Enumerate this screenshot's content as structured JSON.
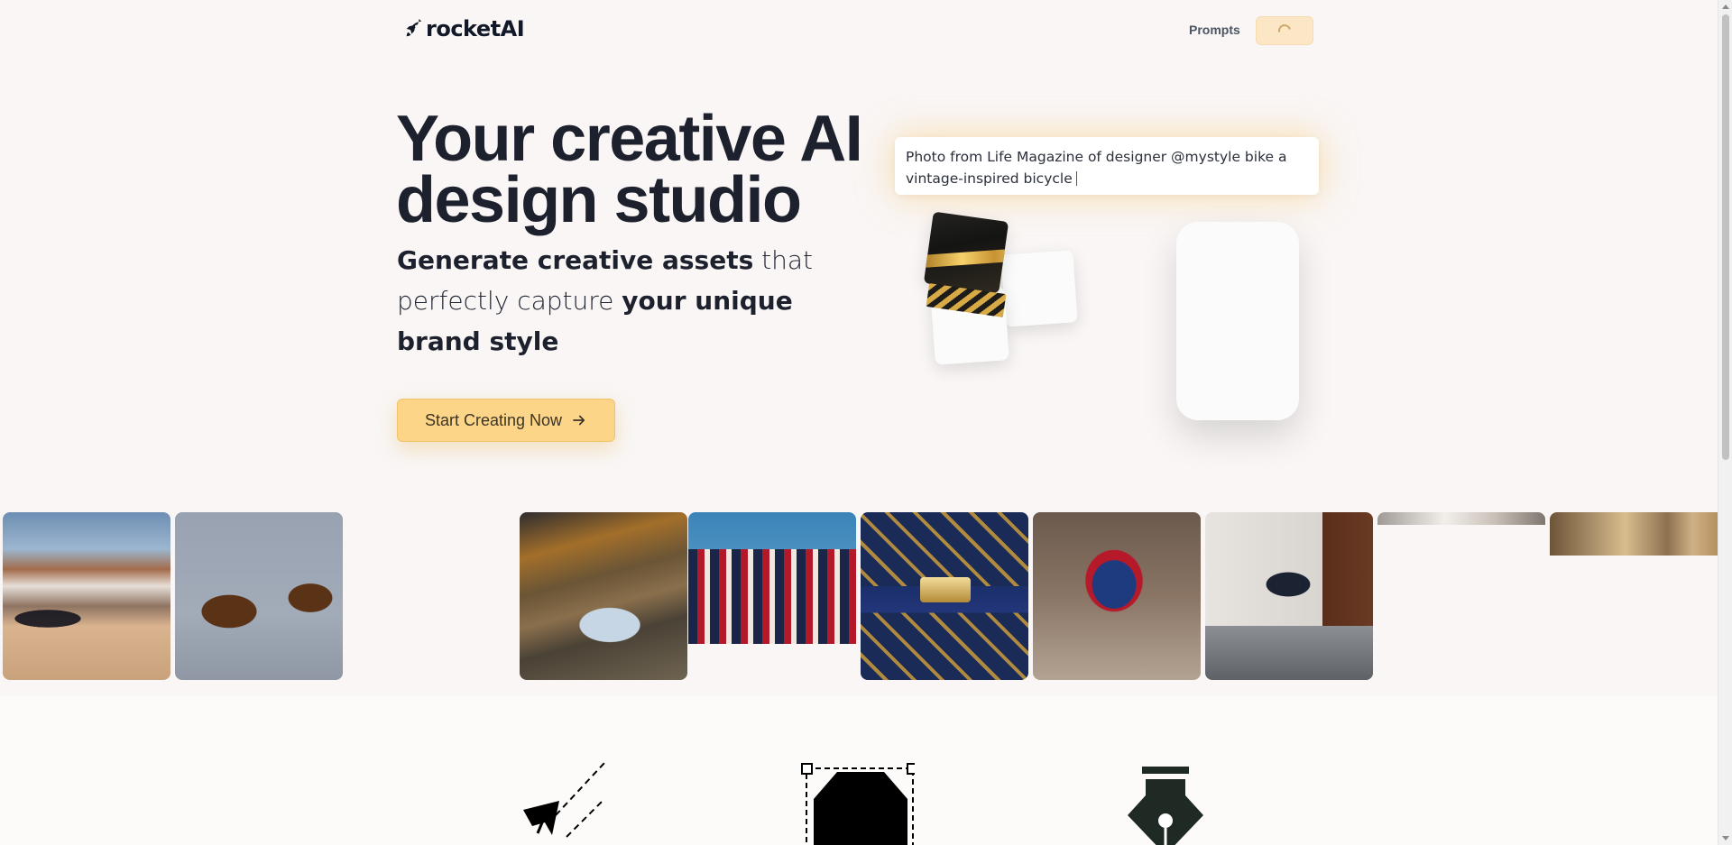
{
  "header": {
    "logo_text": "rocketAI",
    "logo_icon": "rocket-icon",
    "nav_prompts": "Prompts",
    "loading_icon": "spinner-icon"
  },
  "hero": {
    "title": "Your creative AI design studio",
    "subtitle": {
      "part1_bold": "Generate creative assets",
      "part2": " that perfectly capture ",
      "part3_bold": "your unique brand style"
    },
    "cta_label": "Start Creating Now",
    "cta_icon": "arrow-right-icon"
  },
  "prompt_box": {
    "text": "Photo from Life Magazine of designer @mystyle bike a vintage-inspired bicycle"
  },
  "gallery": {
    "tiles": [
      "mountain-sunglasses-image",
      "sunglasses-closeup-image",
      "sports-car-road-image",
      "striped-handbag-image",
      "gold-pattern-handbag-image",
      "red-blue-chair-image",
      "navy-chair-room-image",
      "interior-room-image",
      "interior-wall-image"
    ]
  },
  "features": {
    "icons": [
      "paper-plane-icon",
      "octagon-selection-icon",
      "pen-nib-icon"
    ]
  },
  "colors": {
    "background": "#f9f6f5",
    "accent": "#fcd589",
    "text": "#1c212d"
  }
}
